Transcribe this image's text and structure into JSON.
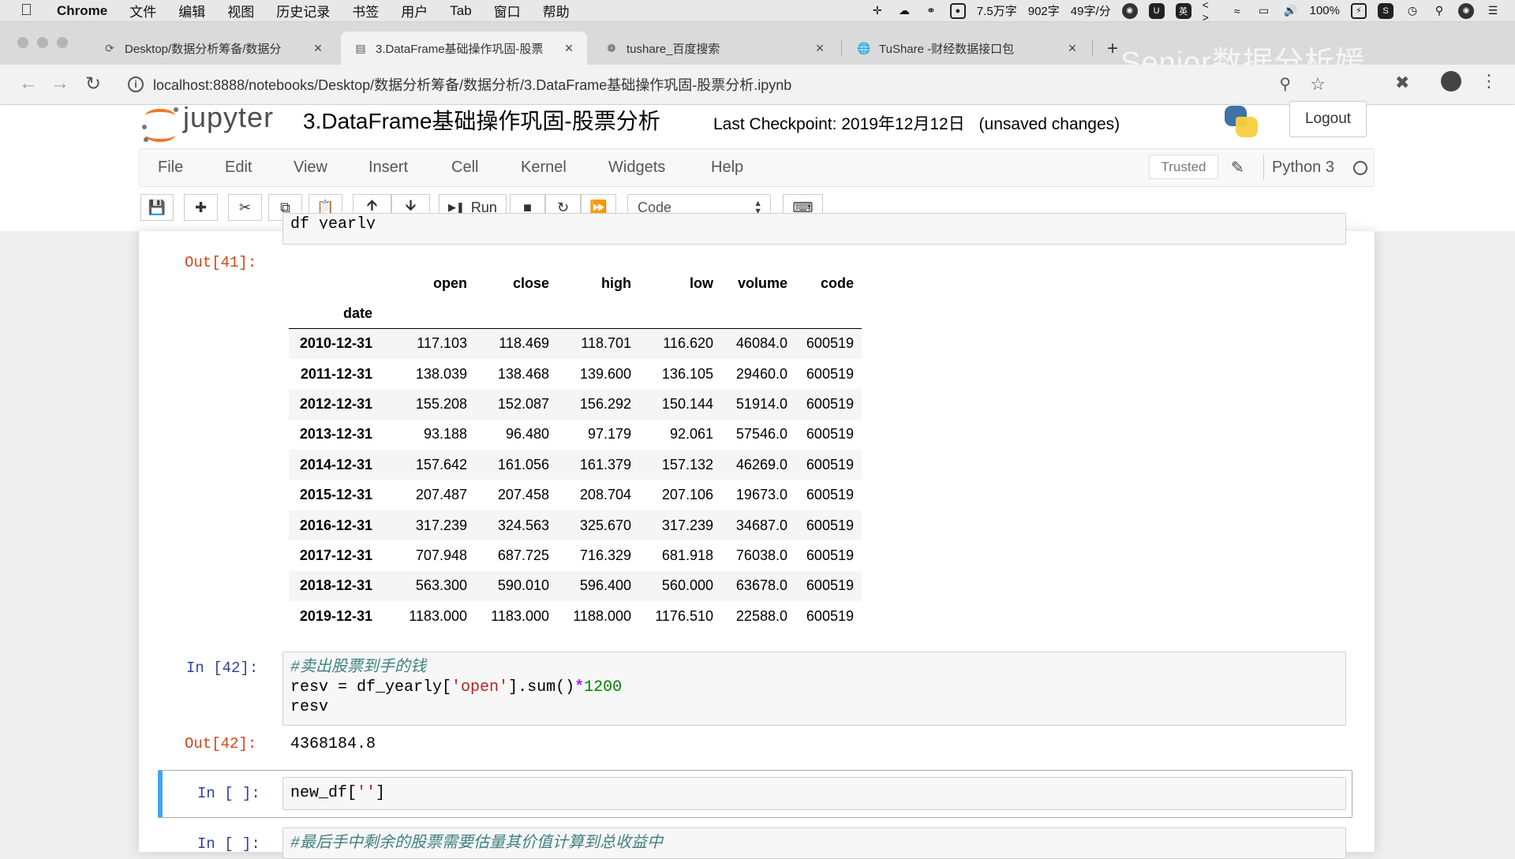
{
  "os_menubar": {
    "app_name": "Chrome",
    "items": [
      "文件",
      "编辑",
      "视图",
      "历史记录",
      "书签",
      "用户",
      "Tab",
      "窗口",
      "帮助"
    ],
    "status": {
      "word_total": "7.5万字",
      "word_count": "902字",
      "speed": "49字/分",
      "battery": "100%",
      "ime": "英"
    }
  },
  "browser": {
    "tabs": [
      {
        "title": "Desktop/数据分析筹备/数据分",
        "icon": "loading-icon",
        "active": false
      },
      {
        "title": "3.DataFrame基础操作巩固-股票",
        "icon": "notebook-icon",
        "active": true
      },
      {
        "title": "tushare_百度搜索",
        "icon": "baidu-paw-icon",
        "active": false
      },
      {
        "title": "TuShare -财经数据接口包",
        "icon": "globe-icon",
        "active": false
      }
    ],
    "new_tab": "+",
    "url": "localhost:8888/notebooks/Desktop/数据分析筹备/数据分析/3.DataFrame基础操作巩固-股票分析.ipynb",
    "watermark": "Senior数据分析媛"
  },
  "jupyter": {
    "logo_text": "jupyter",
    "notebook_title": "3.DataFrame基础操作巩固-股票分析",
    "checkpoint": "Last Checkpoint: 2019年12月12日",
    "unsaved": "(unsaved changes)",
    "logout_label": "Logout",
    "menu": [
      "File",
      "Edit",
      "View",
      "Insert",
      "Cell",
      "Kernel",
      "Widgets",
      "Help"
    ],
    "trusted_label": "Trusted",
    "kernel_name": "Python 3",
    "run_label": "Run",
    "cell_type": "Code"
  },
  "cells": {
    "prev_input_fragment": "df_yearly",
    "out41_prompt": "Out[41]:",
    "dataframe": {
      "columns": [
        "open",
        "close",
        "high",
        "low",
        "volume",
        "code"
      ],
      "index_name": "date",
      "rows": [
        {
          "date": "2010-12-31",
          "values": [
            "117.103",
            "118.469",
            "118.701",
            "116.620",
            "46084.0",
            "600519"
          ]
        },
        {
          "date": "2011-12-31",
          "values": [
            "138.039",
            "138.468",
            "139.600",
            "136.105",
            "29460.0",
            "600519"
          ]
        },
        {
          "date": "2012-12-31",
          "values": [
            "155.208",
            "152.087",
            "156.292",
            "150.144",
            "51914.0",
            "600519"
          ]
        },
        {
          "date": "2013-12-31",
          "values": [
            "93.188",
            "96.480",
            "97.179",
            "92.061",
            "57546.0",
            "600519"
          ]
        },
        {
          "date": "2014-12-31",
          "values": [
            "157.642",
            "161.056",
            "161.379",
            "157.132",
            "46269.0",
            "600519"
          ]
        },
        {
          "date": "2015-12-31",
          "values": [
            "207.487",
            "207.458",
            "208.704",
            "207.106",
            "19673.0",
            "600519"
          ]
        },
        {
          "date": "2016-12-31",
          "values": [
            "317.239",
            "324.563",
            "325.670",
            "317.239",
            "34687.0",
            "600519"
          ]
        },
        {
          "date": "2017-12-31",
          "values": [
            "707.948",
            "687.725",
            "716.329",
            "681.918",
            "76038.0",
            "600519"
          ]
        },
        {
          "date": "2018-12-31",
          "values": [
            "563.300",
            "590.010",
            "596.400",
            "560.000",
            "63678.0",
            "600519"
          ]
        },
        {
          "date": "2019-12-31",
          "values": [
            "1183.000",
            "1183.000",
            "1188.000",
            "1176.510",
            "22588.0",
            "600519"
          ]
        }
      ]
    },
    "in42_prompt": "In [42]:",
    "in42_code": {
      "comment": "#卖出股票到手的钱",
      "line2_a": "resv = df_yearly[",
      "line2_str": "'open'",
      "line2_b": "].sum()",
      "line2_op": "*",
      "line2_num": "1200",
      "line3": "resv"
    },
    "out42_prompt": "Out[42]:",
    "out42_value": "4368184.8",
    "in_empty_prompt": "In [ ]:",
    "in_empty_code_a": "new_df[",
    "in_empty_code_str": "''",
    "in_empty_code_b": "]",
    "in_last_prompt": "In [ ]:",
    "in_last_comment": "#最后手中剩余的股票需要估量其价值计算到总收益中"
  }
}
